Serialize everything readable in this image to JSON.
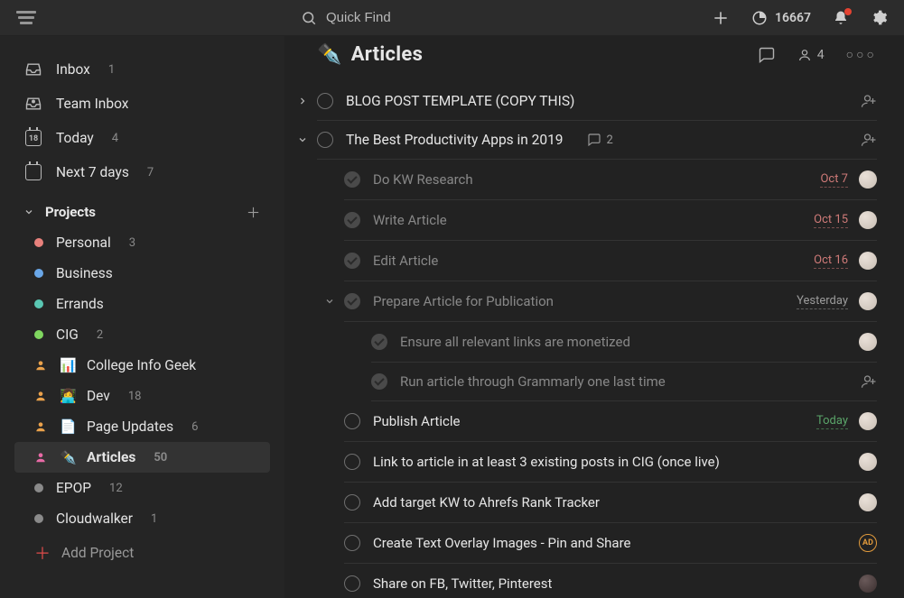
{
  "topbar": {
    "search_placeholder": "Quick Find",
    "karma_points": "16667"
  },
  "sidebar": {
    "inbox": {
      "label": "Inbox",
      "count": "1"
    },
    "team_inbox": {
      "label": "Team Inbox"
    },
    "today": {
      "label": "Today",
      "count": "4",
      "day_num": "18"
    },
    "next7": {
      "label": "Next 7 days",
      "count": "7"
    },
    "projects_header": "Projects",
    "add_project_label": "Add Project",
    "projects": [
      {
        "label": "Personal",
        "count": "3",
        "color": "#e8817c"
      },
      {
        "label": "Business",
        "count": "",
        "color": "#6aa7e8"
      },
      {
        "label": "Errands",
        "count": "",
        "color": "#5ac7b3"
      },
      {
        "label": "CIG",
        "count": "2",
        "color": "#7fd65f"
      },
      {
        "label": "College Info Geek",
        "count": "",
        "emoji": "📊",
        "shared": true
      },
      {
        "label": "Dev",
        "count": "18",
        "emoji": "👩‍💻",
        "shared": true
      },
      {
        "label": "Page Updates",
        "count": "6",
        "emoji": "📄",
        "shared": true
      },
      {
        "label": "Articles",
        "count": "50",
        "emoji": "✒️",
        "shared": true,
        "selected": true
      },
      {
        "label": "EPOP",
        "count": "12",
        "color": "#8a8a8a"
      },
      {
        "label": "Cloudwalker",
        "count": "1",
        "color": "#8a8a8a"
      }
    ]
  },
  "project_view": {
    "emoji": "✒️",
    "title": "Articles",
    "share_count": "4"
  },
  "tasks": [
    {
      "title": "BLOG POST TEMPLATE (COPY THIS)",
      "depth": 0,
      "collapsed": true,
      "assign": true
    },
    {
      "title": "The Best Productivity Apps in 2019",
      "depth": 0,
      "expanded": true,
      "comments": "2",
      "assign": true
    },
    {
      "title": "Do KW Research",
      "depth": 1,
      "completed": true,
      "date": "Oct 7",
      "date_style": "overdue",
      "avatar": true
    },
    {
      "title": "Write Article",
      "depth": 1,
      "completed": true,
      "date": "Oct 15",
      "date_style": "overdue",
      "avatar": true
    },
    {
      "title": "Edit Article",
      "depth": 1,
      "completed": true,
      "date": "Oct 16",
      "date_style": "overdue",
      "avatar": true
    },
    {
      "title": "Prepare Article for Publication",
      "depth": 1,
      "completed": true,
      "expanded": true,
      "date": "Yesterday",
      "date_style": "muted",
      "avatar": true
    },
    {
      "title": "Ensure all relevant links are monetized",
      "depth": 2,
      "completed": true,
      "avatar": true
    },
    {
      "title": "Run article through Grammarly one last time",
      "depth": 2,
      "completed": true,
      "assign": true
    },
    {
      "title": "Publish Article",
      "depth": 1,
      "date": "Today",
      "date_style": "today",
      "avatar": true
    },
    {
      "title": "Link to article in at least 3 existing posts in CIG (once live)",
      "depth": 1,
      "avatar": true
    },
    {
      "title": "Add target KW to Ahrefs Rank Tracker",
      "depth": 1,
      "avatar": true
    },
    {
      "title": "Create Text Overlay Images - Pin and Share",
      "depth": 1,
      "avatar_label": "AD",
      "avatar_style": "orange"
    },
    {
      "title": "Share on FB, Twitter, Pinterest",
      "depth": 1,
      "avatar": true,
      "avatar_style": "dark"
    }
  ]
}
